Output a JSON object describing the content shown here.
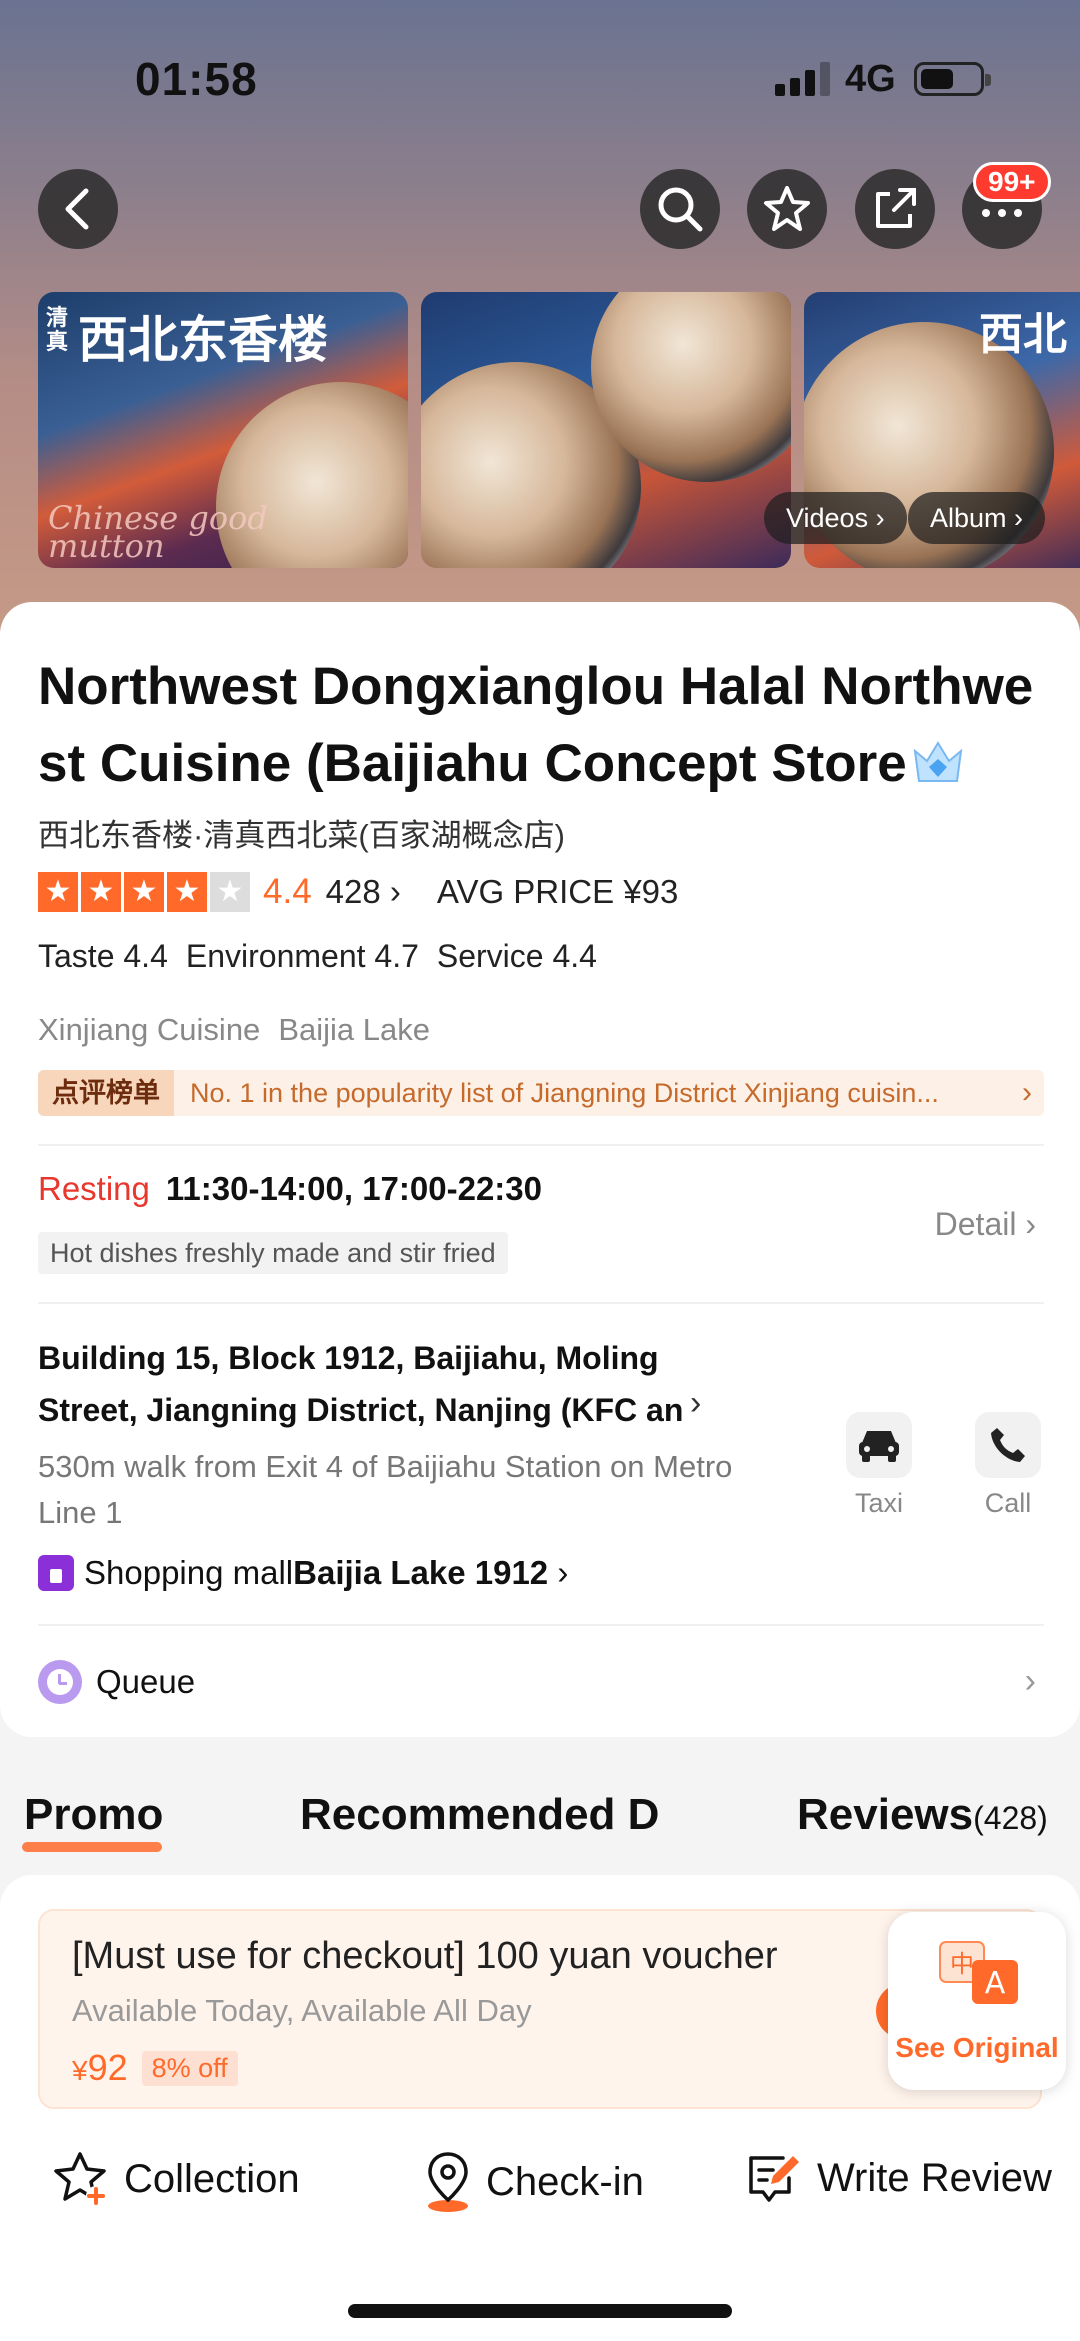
{
  "status_bar": {
    "time": "01:58",
    "network": "4G"
  },
  "header": {
    "notification_badge": "99+"
  },
  "photos": {
    "photo1_brand_cn": "西北东香楼",
    "photo1_tag": "清真",
    "photo1_script": "Chinese good mutton",
    "photo3_brand_cn": "西北",
    "videos_label": "Videos",
    "album_label": "Album"
  },
  "restaurant": {
    "title": "Northwest Dongxianglou Halal Northwest Cuisine (Baijiahu Concept Store",
    "subtitle_cn": "西北东香楼·清真西北菜(百家湖概念店)",
    "rating": "4.4",
    "rating_value": 4.4,
    "reviews_count": "428",
    "avg_price": "AVG PRICE ¥93",
    "sub_scores": [
      "Taste 4.4",
      "Environment 4.7",
      "Service 4.4"
    ],
    "tags": [
      "Xinjiang Cuisine",
      "Baijia Lake"
    ],
    "rank_label": "点评榜单",
    "rank_text": "No. 1 in the popularity list of Jiangning District Xinjiang cuisin..."
  },
  "hours": {
    "status": "Resting",
    "times": "11:30-14:00, 17:00-22:30",
    "note": "Hot dishes freshly made and stir fried",
    "detail_label": "Detail"
  },
  "location": {
    "address": "Building 15, Block 1912, Baijiahu, Moling Street, Jiangning District, Nanjing (KFC an",
    "walk": "530m walk from Exit 4 of Baijiahu Station on Metro Line 1",
    "mall_prefix": "Shopping mall",
    "mall_name": "Baijia Lake 1912",
    "taxi_label": "Taxi",
    "call_label": "Call"
  },
  "queue": {
    "label": "Queue"
  },
  "tabs": {
    "promo": "Promo",
    "recommended": "Recommended D",
    "reviews": "Reviews",
    "reviews_count": "(428)"
  },
  "voucher": {
    "title": "[Must use for checkout] 100 yuan voucher",
    "availability": "Available Today, Available All Day",
    "yen": "¥",
    "price": "92",
    "discount": "8% off"
  },
  "see_original": {
    "label": "See Original"
  },
  "bottom_bar": {
    "collection": "Collection",
    "checkin": "Check-in",
    "write_review": "Write Review"
  },
  "colors": {
    "accent": "#ff6a2a",
    "resting_red": "#e8372d",
    "rank_text": "#c66a2c",
    "mall_purple": "#8b2fd8"
  }
}
